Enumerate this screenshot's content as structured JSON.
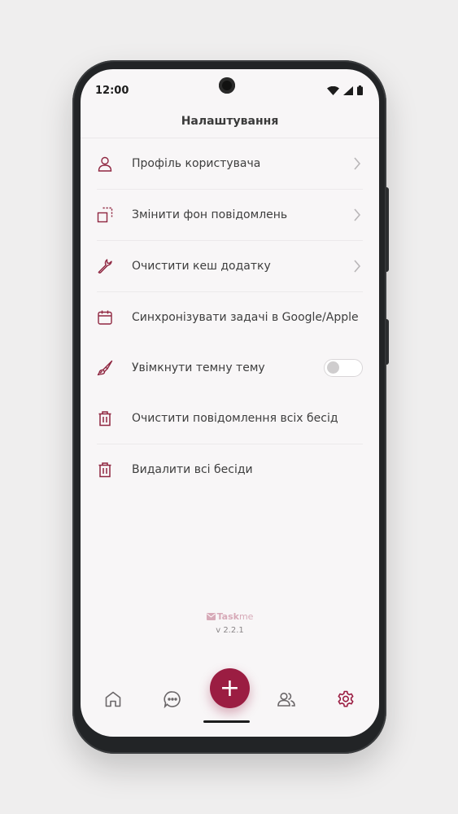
{
  "status": {
    "time": "12:00"
  },
  "header": {
    "title": "Налаштування"
  },
  "settings": {
    "items": [
      {
        "label": "Профіль користувача",
        "icon": "user-icon"
      },
      {
        "label": "Змінити фон повідомлень",
        "icon": "background-icon"
      },
      {
        "label": "Очистити кеш додатку",
        "icon": "wrench-icon"
      },
      {
        "label": "Синхронізувати задачі в Google/Apple",
        "icon": "calendar-icon"
      },
      {
        "label": "Увімкнути темну тему",
        "icon": "brush-icon",
        "toggle": false
      },
      {
        "label": "Очистити повідомлення всіх бесід",
        "icon": "trash-icon"
      },
      {
        "label": "Видалити всі бесіди",
        "icon": "trash-icon"
      }
    ]
  },
  "footer": {
    "brand_task": "Task",
    "brand_me": "me",
    "version": "v 2.2.1"
  },
  "nav": {
    "fab_label": "+"
  },
  "colors": {
    "accent": "#9b1d42",
    "icon": "#8f2640",
    "text": "#3e3e3e",
    "background": "#f8f6f7"
  }
}
